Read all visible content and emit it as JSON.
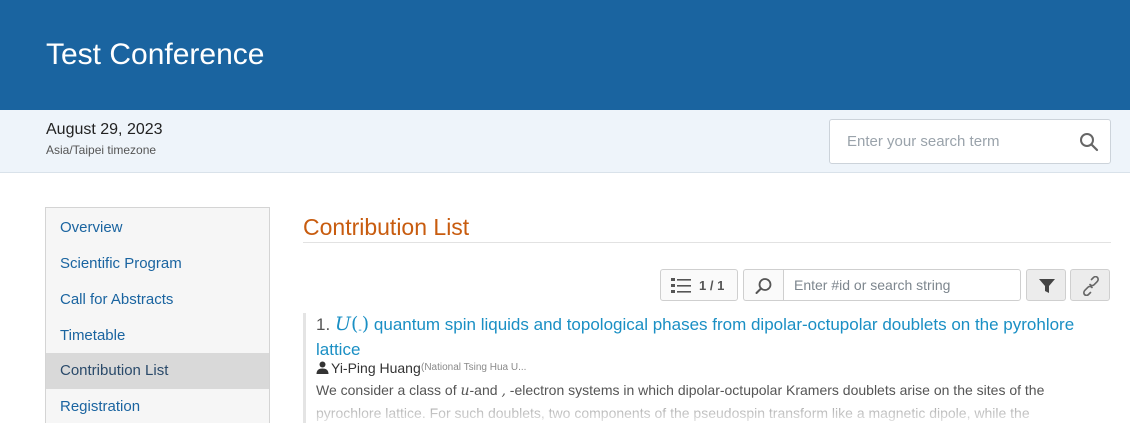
{
  "header": {
    "title": "Test Conference"
  },
  "event": {
    "date": "August 29, 2023",
    "timezone": "Asia/Taipei timezone"
  },
  "search": {
    "placeholder": "Enter your search term"
  },
  "menu": {
    "items": [
      {
        "label": "Overview",
        "active": false
      },
      {
        "label": "Scientific Program",
        "active": false
      },
      {
        "label": "Call for Abstracts",
        "active": false
      },
      {
        "label": "Timetable",
        "active": false
      },
      {
        "label": "Contribution List",
        "active": true
      },
      {
        "label": "Registration",
        "active": false
      }
    ]
  },
  "main": {
    "title": "Contribution List",
    "toolbar": {
      "pager": "1 / 1",
      "filter_placeholder": "Enter #id or search string"
    },
    "contributions": [
      {
        "number": "1.",
        "math_symbol": "U",
        "math_open": "(",
        "math_sub": "‐",
        "math_close": ")",
        "title": "quantum spin liquids and topological phases from dipolar-octupolar doublets on the pyrohlore lattice",
        "author": "Yi-Ping Huang",
        "affiliation": "(National Tsing Hua U...",
        "abstract_a": "We consider a class of ",
        "abstract_sym1": "u",
        "abstract_b": "-and ",
        "abstract_sym2": ",",
        "abstract_c": " -electron systems in which dipolar-octupolar Kramers doublets arise on the sites of the pyrochlore lattice. For such doublets, two components of the pseudospin transform like a magnetic dipole, while the"
      }
    ]
  },
  "colors": {
    "header_bg": "#1a64a0",
    "accent_title": "#c85c0f",
    "link": "#1a8fc4"
  }
}
